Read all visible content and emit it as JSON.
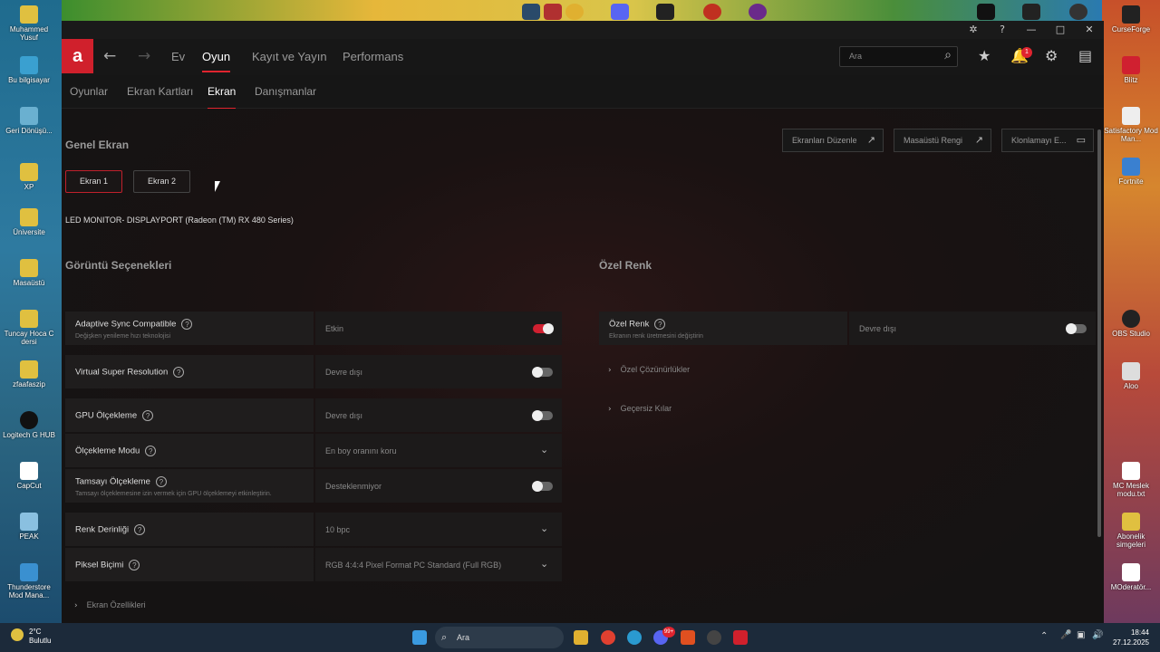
{
  "window": {
    "brand_letter": "a",
    "nav": {
      "back_icon": "arrow-left-icon",
      "forward_icon": "arrow-right-icon",
      "links": [
        "Ev",
        "Oyun",
        "Kayıt ve Yayın",
        "Performans"
      ],
      "active": "Oyun"
    },
    "search_placeholder": "Ara",
    "notification_count": "1",
    "subnav": {
      "links": [
        "Oyunlar",
        "Ekran Kartları",
        "Ekran",
        "Danışmanlar"
      ],
      "active": "Ekran"
    }
  },
  "general": {
    "title": "Genel Ekran",
    "buttons": [
      "Ekranları Düzenle",
      "Masaüstü Rengi",
      "Klonlamayı E..."
    ],
    "displays": [
      "Ekran 1",
      "Ekran 2"
    ],
    "monitor_name": "LED MONITOR- DISPLAYPORT (Radeon (TM) RX 480 Series)"
  },
  "display_options": {
    "title": "Görüntü Seçenekleri",
    "rows": [
      {
        "label": "Adaptive Sync Compatible",
        "sub": "Değişken yenileme hızı teknolojisi",
        "value": "Etkin",
        "control": "toggle-on"
      },
      {
        "label": "Virtual Super Resolution",
        "sub": "",
        "value": "Devre dışı",
        "control": "toggle-off"
      },
      {
        "label": "GPU Ölçekleme",
        "sub": "",
        "value": "Devre dışı",
        "control": "toggle-off"
      },
      {
        "label": "Ölçekleme Modu",
        "sub": "",
        "value": "En boy oranını koru",
        "control": "dropdown"
      },
      {
        "label": "Tamsayı Ölçekleme",
        "sub": "Tamsayı ölçeklemesine izin vermek için GPU ölçeklemeyi etkinleştirin.",
        "value": "Desteklenmiyor",
        "control": "toggle-off"
      },
      {
        "label": "Renk Derinliği",
        "sub": "",
        "value": "10 bpc",
        "control": "dropdown"
      },
      {
        "label": "Piksel Biçimi",
        "sub": "",
        "value": "RGB 4:4:4 Pixel Format PC Standard (Full RGB)",
        "control": "dropdown"
      }
    ],
    "expander": "Ekran Özellikleri"
  },
  "custom_color": {
    "title": "Özel Renk",
    "row": {
      "label": "Özel Renk",
      "sub": "Ekranın renk üretmesini değiştirin",
      "value": "Devre dışı"
    },
    "expanders": [
      "Özel Çözünürlükler",
      "Geçersiz Kılar"
    ]
  },
  "desktop": {
    "left_icons": [
      "Muhammed Yusuf",
      "Bu bilgisayar",
      "Geri Dönüşü...",
      "XP",
      "Üniversite",
      "Masaüstü",
      "Tuncay Hoca C dersi",
      "zfaafaszip",
      "Logitech G HUB",
      "CapCut",
      "PEAK",
      "Thunderstore Mod Mana..."
    ],
    "right_icons": [
      "CurseForge",
      "Blitz",
      "Satisfactory Mod Man...",
      "Fortnite",
      "OBS Studio",
      "Aloo",
      "MC Meslek modu.txt",
      "Abonelik simgeleri",
      "MOderatör..."
    ]
  },
  "taskbar": {
    "weather_temp": "2°C",
    "weather_desc": "Bulutlu",
    "search": "Ara",
    "time": "18:44",
    "date": "27.12.2025",
    "app_badge": "99+"
  },
  "colors": {
    "accent": "#e0242f",
    "bg": "#141414"
  }
}
